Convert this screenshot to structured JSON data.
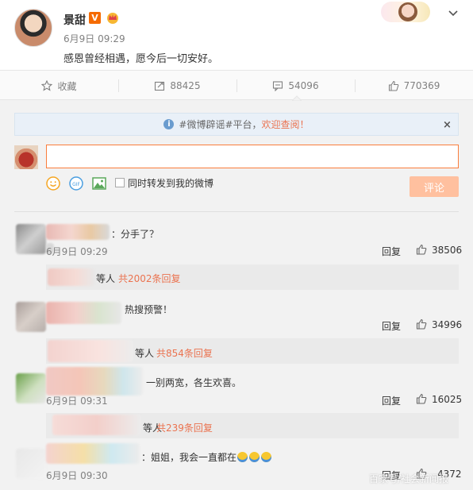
{
  "post": {
    "author": "景甜",
    "verified_badge": "V",
    "time": "6月9日 09:29",
    "text": "感恩曾经相遇，愿今后一切安好。"
  },
  "actions": {
    "favorite": "收藏",
    "repost_count": "88425",
    "comment_count": "54096",
    "like_count": "770369"
  },
  "notice": {
    "info_icon": "i",
    "prefix": "#微博辟谣#平台，",
    "highlight": "欢迎查阅！",
    "close": "×"
  },
  "composer": {
    "input_value": "",
    "repost_label": "同时转发到我的微博",
    "submit_label": "评论"
  },
  "comments": [
    {
      "text": "：分手了？",
      "time": "6月9日 09:29",
      "reply": "回复",
      "likes": "38506",
      "sub_prefix": "等人",
      "sub_link": "共2002条回复"
    },
    {
      "text": "热搜预警！",
      "time": "",
      "reply": "回复",
      "likes": "34996",
      "sub_prefix": "等人",
      "sub_link": "共854条回复"
    },
    {
      "text": "一别两宽，各生欢喜。",
      "time": "6月9日 09:31",
      "reply": "回复",
      "likes": "16025",
      "sub_prefix": "等人",
      "sub_link": "共239条回复"
    },
    {
      "text": "：姐姐，我会一直都在",
      "time": "6月9日 09:30",
      "reply": "回复",
      "likes": "4372"
    }
  ],
  "watermark": "百家号/社会新闻报",
  "colors": {
    "accent": "#fa7d3c",
    "link": "#eb7350",
    "notice_bg": "#e9f0f8",
    "submit_disabled": "#ffc09f"
  },
  "icons": [
    "more-icon",
    "star-icon",
    "repost-icon",
    "comment-icon",
    "thumb-up-icon",
    "info-icon",
    "close-icon",
    "smile-icon",
    "gif-icon",
    "image-icon"
  ]
}
